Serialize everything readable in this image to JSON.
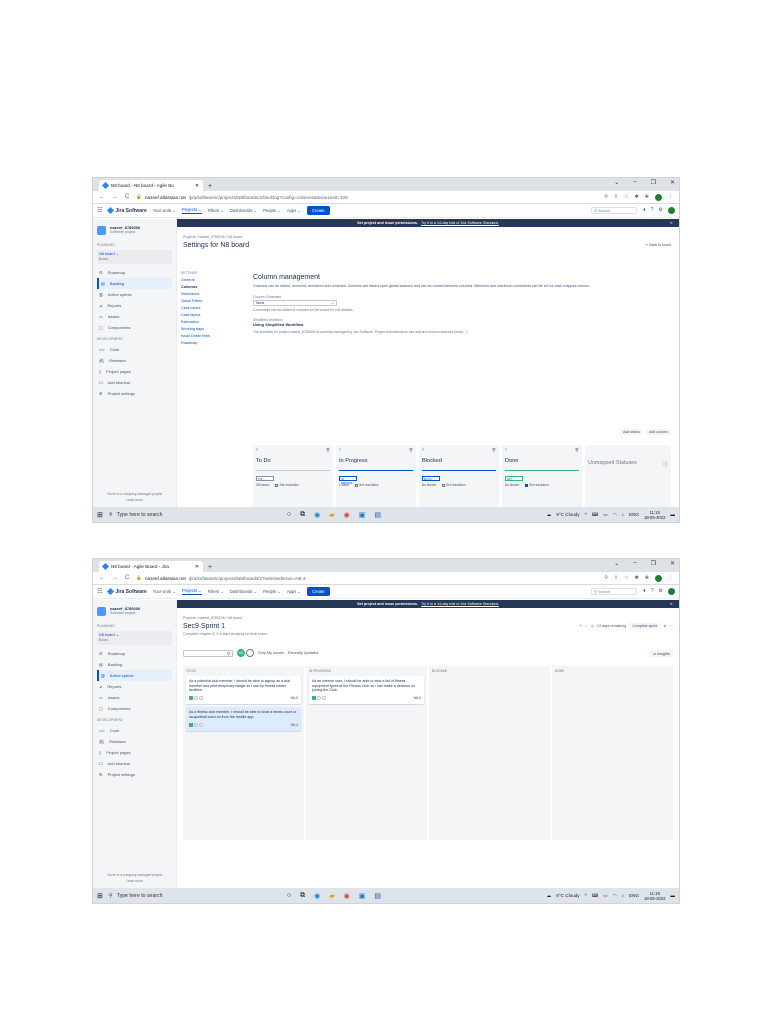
{
  "screens": [
    {
      "tab_title": "N8 board - N8 board - Agile Bo",
      "url_host": "nazeef.atlassian.net",
      "url_path": "/jira/software/c/projects/N8/boards/2/backlog?config=columns&issueLimit=100",
      "banner_text": "Set project and issue permissions.",
      "banner_link": "Try it in a 14-day trial of Jira Software Standard.",
      "breadcrumb": "Projects / nazeef_8789206 / N8 board",
      "page_title": "Settings for N8 board",
      "back_link": "⇐ Back to board",
      "settings_header": "SETTINGS",
      "settings_items": [
        "General",
        "Columns",
        "Swimlanes",
        "Quick Filters",
        "Card colors",
        "Card layout",
        "Estimation",
        "Working days",
        "Issue Detail View",
        "Roadmap"
      ],
      "cm_title": "Column management",
      "cm_desc": "Columns can be added, removed, reordered and renamed. Columns are based upon global statuses and can be moved between columns. Minimum and maximum constraints can be set for each mapped column.",
      "cm_constraint_label": "Column Constraint",
      "cm_constraint_value": "None",
      "cm_constraint_note": "Constraints can be added to columns on the board for one statistic.",
      "cm_workflow_label": "Simplified Workflow",
      "cm_workflow_value": "Using Simplified Workflow",
      "cm_workflow_note": "The workflow for project nazeef_8789206 is currently managed by Jira Software. Project Administrators can add and remove statuses below.",
      "btn_add_status": "Add status",
      "btn_add_column": "Add column",
      "columns": [
        {
          "name": "To Do",
          "status": "TO ...",
          "issues": "38 issues",
          "resolution": "Set resolution",
          "checked": false
        },
        {
          "name": "In Progress",
          "status": "IN PROGR...",
          "issues": "1 issue",
          "resolution": "Set resolution",
          "checked": false
        },
        {
          "name": "Blocked",
          "status": "BLOC...",
          "issues": "No issues",
          "resolution": "Set resolution",
          "checked": false
        },
        {
          "name": "Done",
          "status": "DO...",
          "issues": "No issues",
          "resolution": "Set resolution",
          "checked": true
        }
      ],
      "unmapped": "Unmapped Statuses",
      "time": "11:15",
      "date": "18-05-2022"
    },
    {
      "tab_title": "N8 board - Agile Board - Jira",
      "url_host": "nazeef.atlassian.net",
      "url_path": "/jira/software/c/projects/N8/boards/2?selectedIssue=N8-4",
      "banner_text": "Set project and issue permissions.",
      "banner_link": "Try it in a 14-day trial of Jira Software Standard.",
      "breadcrumb": "Projects / nazeef_8789206 / N8 board",
      "page_title": "Sec9 Sprint 1",
      "page_subtitle": "Complete chapter 6, 9 & start studying for final exam.",
      "days_remaining": "13 days remaining",
      "complete_sprint": "Complete sprint",
      "only_my_issues": "Only My Issues",
      "recently_updated": "Recently Updated",
      "insights": "Insights",
      "avatar_initials": "NG",
      "lanes": [
        {
          "name": "TO DO",
          "cards": [
            {
              "text": "As a potential club member, I should be able to signup as a trial member and print temporary badge so I can try fitness center facilities.",
              "key": "N8-5",
              "hl": false
            },
            {
              "text": "As a fitness club member, I should be able to book a tennis court or racquetball court on from the mobile app.",
              "key": "N8-4",
              "hl": true
            }
          ]
        },
        {
          "name": "IN PROGRESS",
          "cards": [
            {
              "text": "As an internet user, I should be able to view a list of fitness equipment types at the Fitness Club so I can make a decision on joining the Club.",
              "key": "N8-6",
              "hl": false
            }
          ]
        },
        {
          "name": "BLOCKED",
          "cards": []
        },
        {
          "name": "DONE",
          "cards": []
        }
      ],
      "time": "11:19",
      "date": "18-05-2022"
    }
  ],
  "top_nav": {
    "product": "Jira Software",
    "items": [
      "Your work ⌄",
      "Projects ⌄",
      "Filters ⌄",
      "Dashboards ⌄",
      "People ⌄",
      "Apps ⌄"
    ],
    "create": "Create",
    "search": "Search"
  },
  "sidebar": {
    "project_name": "nazeef_8789206",
    "project_type": "Software project",
    "planning_label": "PLANNING",
    "board_name": "N8 board",
    "board_sub": "Board",
    "items_planning": [
      "Roadmap",
      "Backlog",
      "Active sprints",
      "Reports"
    ],
    "items_mid": [
      "Issues",
      "Components"
    ],
    "dev_label": "DEVELOPMENT",
    "items_dev": [
      "Code",
      "Releases"
    ],
    "items_bottom": [
      "Project pages",
      "Add shortcut",
      "Project settings"
    ],
    "footer": "You're in a company-managed project",
    "footer_link": "Learn more"
  },
  "taskbar": {
    "search_placeholder": "Type here to search",
    "weather": "9°C Cloudy",
    "lang": "ENG"
  }
}
